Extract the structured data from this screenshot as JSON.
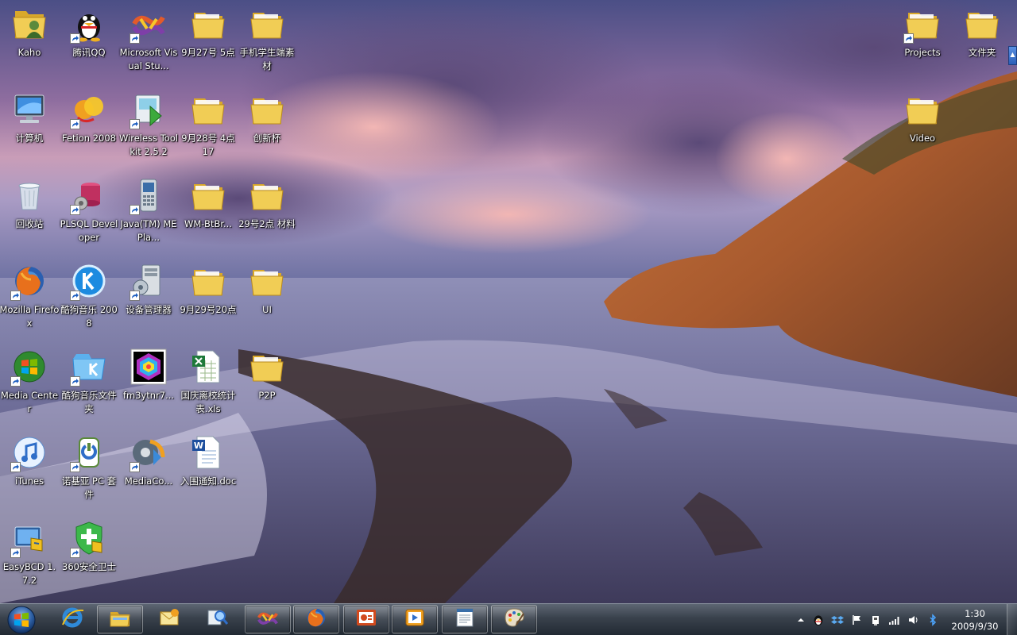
{
  "desktop": {
    "icons": [
      {
        "label": "Kaho",
        "icon": "user-folder-icon",
        "shortcut": false
      },
      {
        "label": "计算机",
        "icon": "computer-icon",
        "shortcut": false
      },
      {
        "label": "回收站",
        "icon": "recycle-bin-icon",
        "shortcut": false
      },
      {
        "label": "Mozilla Firefox",
        "icon": "firefox-icon",
        "shortcut": true
      },
      {
        "label": "Media Center",
        "icon": "media-center-icon",
        "shortcut": true
      },
      {
        "label": "iTunes",
        "icon": "itunes-icon",
        "shortcut": true
      },
      {
        "label": "EasyBCD 1.7.2",
        "icon": "easybcd-icon",
        "shortcut": true
      },
      {
        "label": "腾讯QQ",
        "icon": "qq-penguin-icon",
        "shortcut": true
      },
      {
        "label": "Fetion 2008",
        "icon": "fetion-icon",
        "shortcut": true
      },
      {
        "label": "PLSQL Developer",
        "icon": "plsql-developer-icon",
        "shortcut": true
      },
      {
        "label": "酷狗音乐 2008",
        "icon": "kugou-icon",
        "shortcut": true
      },
      {
        "label": "酷狗音乐文件夹",
        "icon": "kugou-folder-icon",
        "shortcut": true
      },
      {
        "label": "诺基亚 PC 套件",
        "icon": "nokia-pc-suite-icon",
        "shortcut": true
      },
      {
        "label": "360安全卫士",
        "icon": "360-safe-icon",
        "shortcut": true
      },
      {
        "label": "Microsoft Visual Stu...",
        "icon": "visual-studio-icon",
        "shortcut": true
      },
      {
        "label": "Wireless Toolkit 2.5.2",
        "icon": "wireless-toolkit-icon",
        "shortcut": true
      },
      {
        "label": "Java(TM) ME Pla...",
        "icon": "java-me-phone-icon",
        "shortcut": true
      },
      {
        "label": "设备管理器",
        "icon": "device-manager-icon",
        "shortcut": true
      },
      {
        "label": "fm3ytnr7...",
        "icon": "color-hexagon-image-icon",
        "shortcut": false
      },
      {
        "label": "MediaCo...",
        "icon": "media-coder-icon",
        "shortcut": true
      },
      {
        "label": "9月27号 5点",
        "icon": "folder-icon",
        "shortcut": false
      },
      {
        "label": "9月28号 4点 17",
        "icon": "folder-icon",
        "shortcut": false
      },
      {
        "label": "WM-BtBr...",
        "icon": "folder-icon",
        "shortcut": false
      },
      {
        "label": "9月29号20点",
        "icon": "folder-icon",
        "shortcut": false
      },
      {
        "label": "国庆离校统计表.xls",
        "icon": "excel-file-icon",
        "shortcut": false
      },
      {
        "label": "入围通知.doc",
        "icon": "word-file-icon",
        "shortcut": false
      },
      {
        "label": "手机学生端素材",
        "icon": "folder-icon",
        "shortcut": false
      },
      {
        "label": "创新杯",
        "icon": "folder-icon",
        "shortcut": false
      },
      {
        "label": "29号2点 材料",
        "icon": "folder-icon",
        "shortcut": false
      },
      {
        "label": "UI",
        "icon": "folder-icon",
        "shortcut": false
      },
      {
        "label": "P2P",
        "icon": "folder-icon",
        "shortcut": false
      },
      {
        "label": "Projects",
        "icon": "folder-icon",
        "shortcut": true
      },
      {
        "label": "Video",
        "icon": "folder-icon",
        "shortcut": false
      },
      {
        "label": "文件夹",
        "icon": "folder-icon",
        "shortcut": false
      }
    ]
  },
  "taskbar": {
    "start": {
      "icon": "windows-start-orb-icon"
    },
    "buttons": [
      {
        "icon": "internet-explorer-icon",
        "running": false
      },
      {
        "icon": "windows-explorer-icon",
        "running": true
      },
      {
        "icon": "outlook-mail-icon",
        "running": false
      },
      {
        "icon": "search-tool-icon",
        "running": false
      },
      {
        "icon": "visual-studio-icon",
        "running": true
      },
      {
        "icon": "firefox-icon",
        "running": true
      },
      {
        "icon": "presentation-app-icon",
        "running": true
      },
      {
        "icon": "media-player-icon",
        "running": true
      },
      {
        "icon": "document-window-icon",
        "running": true
      },
      {
        "icon": "paint-palette-icon",
        "running": true
      }
    ]
  },
  "tray": {
    "icons": [
      "show-hidden-icons-icon",
      "qq-penguin-icon",
      "dropbox-icon",
      "action-center-flag-icon",
      "usb-device-icon",
      "signal-bars-icon",
      "volume-icon",
      "bluetooth-icon"
    ],
    "time": "1:30",
    "date": "2009/9/30"
  }
}
